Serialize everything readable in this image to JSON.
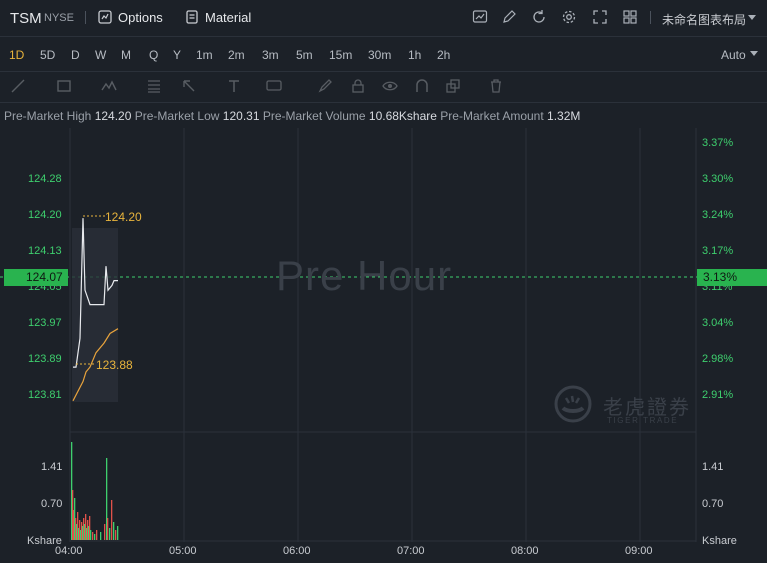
{
  "header": {
    "ticker": "TSM",
    "exchange": "NYSE",
    "options_label": "Options",
    "material_label": "Material",
    "layout_name": "未命名图表布局"
  },
  "periods": [
    "1D",
    "5D",
    "D",
    "W",
    "M",
    "Q",
    "Y",
    "1m",
    "2m",
    "3m",
    "5m",
    "15m",
    "30m",
    "1h",
    "2h"
  ],
  "active_period": "1D",
  "auto_label": "Auto",
  "info": {
    "high_label": "Pre-Market High",
    "high_value": "124.20",
    "low_label": "Pre-Market Low",
    "low_value": "120.31",
    "volume_label": "Pre-Market Volume",
    "volume_value": "10.68Kshare",
    "amount_label": "Pre-Market Amount",
    "amount_value": "1.32M"
  },
  "price_axis_left": [
    "124.28",
    "124.20",
    "124.13",
    "124.05",
    "123.97",
    "123.89",
    "123.81"
  ],
  "price_axis_right": [
    "3.37%",
    "3.30%",
    "3.24%",
    "3.17%",
    "3.11%",
    "3.04%",
    "2.98%",
    "2.91%"
  ],
  "current_price": "124.07",
  "current_pct": "3.13%",
  "high_marker": "124.20",
  "low_marker": "123.88",
  "watermark": "Pre Hour",
  "brand": {
    "name": "老虎證券",
    "sub": "TIGER TRADE"
  },
  "volume_axis": [
    "1.41",
    "0.70"
  ],
  "volume_unit": "Kshare",
  "time_axis": [
    "04:00",
    "05:00",
    "06:00",
    "07:00",
    "08:00",
    "09:00"
  ],
  "chart_data": {
    "type": "line",
    "series": [
      {
        "values": [
          123.89,
          124.2,
          124.05,
          124.05,
          124.05,
          124.05,
          124.07,
          124.07
        ]
      },
      {
        "values": [
          123.82,
          123.86,
          123.88,
          123.89,
          123.92,
          123.94,
          123.96,
          123.97
        ]
      }
    ],
    "ylim": [
      123.78,
      124.35
    ]
  },
  "colors": {
    "up": "#3ecf6e",
    "down": "#e0514a",
    "accent": "#e8b43c"
  }
}
